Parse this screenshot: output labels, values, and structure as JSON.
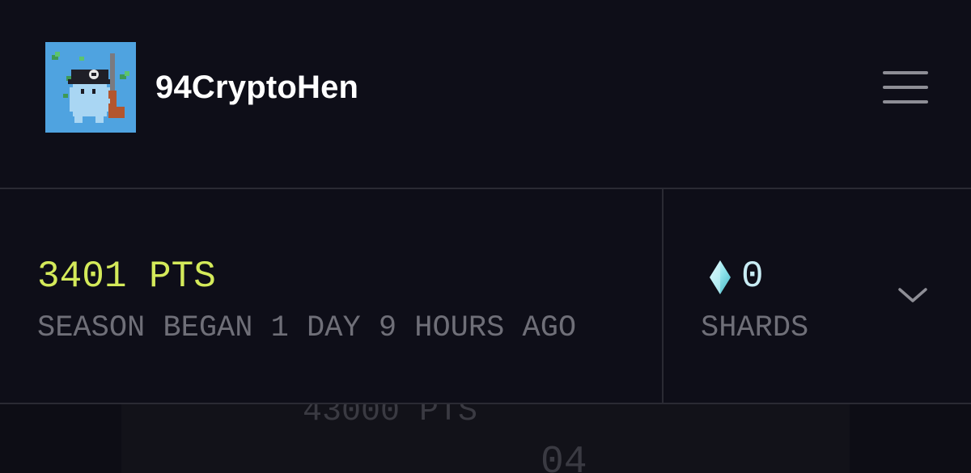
{
  "header": {
    "username": "94CryptoHen",
    "avatar_icon": "pixel-character-avatar",
    "menu_icon": "hamburger-menu-icon"
  },
  "stats": {
    "points": "3401 PTS",
    "season_text": "SEASON BEGAN 1 DAY 9 HOURS AGO",
    "shards_count": "0",
    "shards_label": "SHARDS",
    "shard_icon": "diamond-shard-icon",
    "expand_icon": "chevron-down-icon"
  },
  "below": {
    "faded_points": "43000 PTS",
    "faded_rank": "04"
  },
  "colors": {
    "background": "#0e0e18",
    "points_accent": "#d4ea5a",
    "shard_accent": "#c8ecf4",
    "muted_text": "#6f6f78",
    "divider": "#2a2a33"
  }
}
